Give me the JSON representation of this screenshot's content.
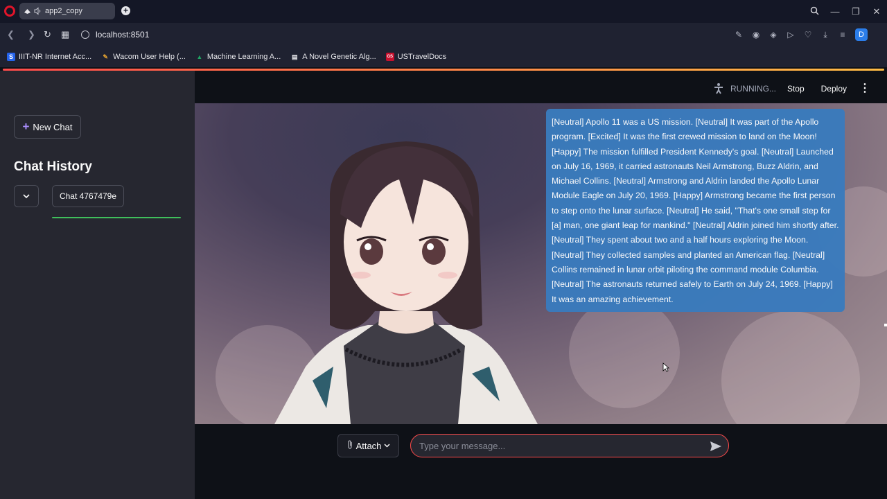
{
  "browser": {
    "tab_title": "app2_copy",
    "url": "localhost:8501",
    "profile_initial": "D",
    "bookmarks": [
      {
        "label": "IIIT-NR Internet Acc...",
        "icon": "S",
        "color": "#2563eb"
      },
      {
        "label": "Wacom User Help (...",
        "icon": "✎",
        "color": "#555555"
      },
      {
        "label": "Machine Learning A...",
        "icon": "▲",
        "color": "#1fa463"
      },
      {
        "label": "A Novel Genetic Alg...",
        "icon": "▤",
        "color": "#6b6f80"
      },
      {
        "label": "USTravelDocs",
        "icon": "GS",
        "color": "#c8102e"
      }
    ]
  },
  "sidebar": {
    "new_chat_label": "New Chat",
    "history_title": "Chat History",
    "chats": [
      {
        "label": "Chat 4767479e"
      }
    ]
  },
  "header": {
    "status": "RUNNING...",
    "stop_label": "Stop",
    "deploy_label": "Deploy"
  },
  "chat": {
    "response": "[Neutral] Apollo 11 was a US mission. [Neutral] It was part of the Apollo program. [Excited] It was the first crewed mission to land on the Moon! [Happy] The mission fulfilled President Kennedy's goal. [Neutral] Launched on July 16, 1969, it carried astronauts Neil Armstrong, Buzz Aldrin, and Michael Collins. [Neutral] Armstrong and Aldrin landed the Apollo Lunar Module Eagle on July 20, 1969. [Happy] Armstrong became the first person to step onto the lunar surface. [Neutral] He said, \"That's one small step for [a] man, one giant leap for mankind.\" [Neutral] Aldrin joined him shortly after. [Neutral] They spent about two and a half hours exploring the Moon. [Neutral] They collected samples and planted an American flag. [Neutral] Collins remained in lunar orbit piloting the command module Columbia. [Neutral] The astronauts returned safely to Earth on July 24, 1969. [Happy] It was an amazing achievement."
  },
  "input": {
    "attach_label": "Attach",
    "placeholder": "Type your message...",
    "value": ""
  },
  "colors": {
    "accent": "#ff4b4b",
    "bubble": "#3a7bbd",
    "sidebar_bg": "#262730",
    "app_bg": "#0e1117",
    "progress": "#3fbf5b"
  }
}
